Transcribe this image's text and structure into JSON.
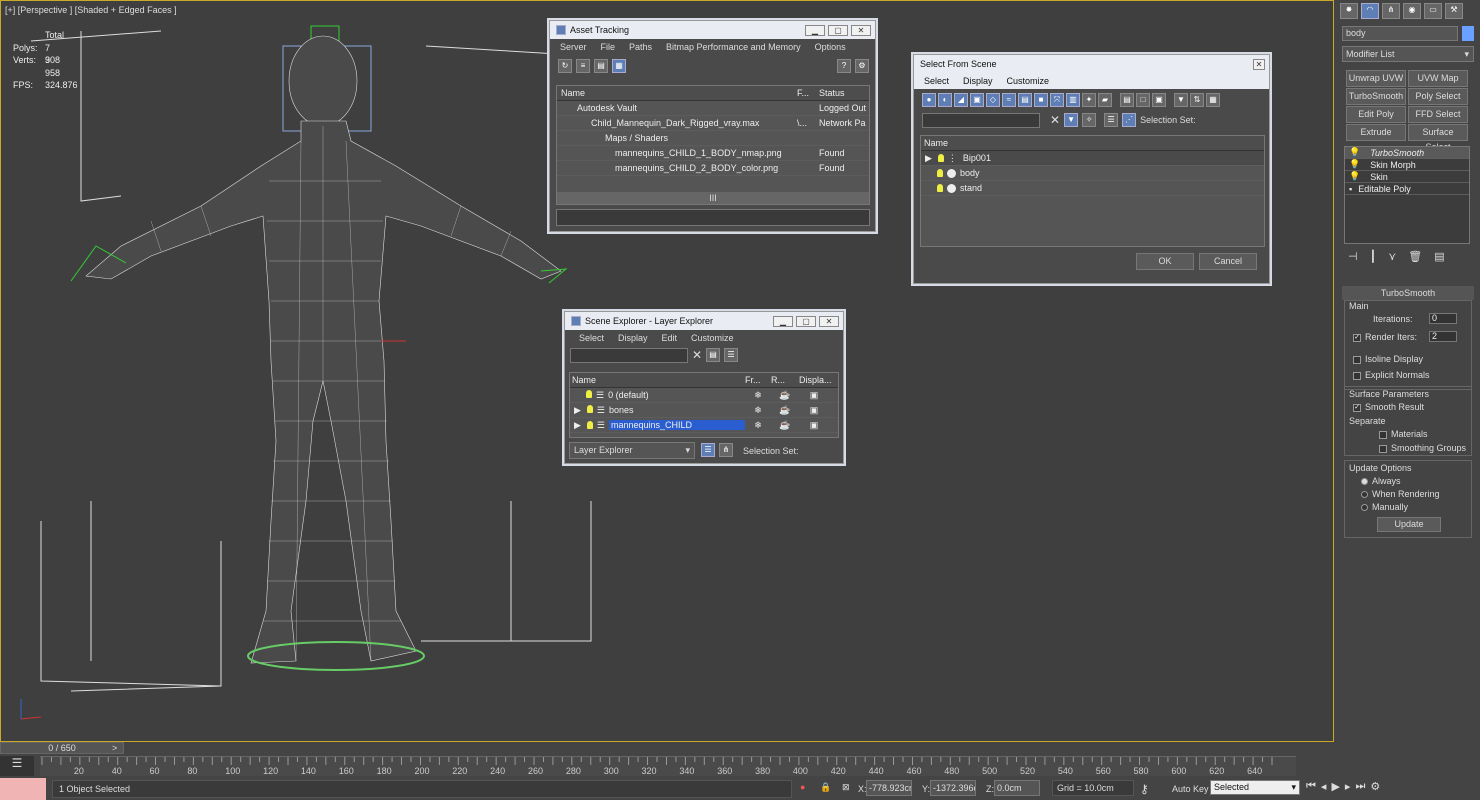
{
  "viewport": {
    "label": "[+] [Perspective ] [Shaded + Edged Faces ]",
    "stats": {
      "total": "Total",
      "polys_label": "Polys:",
      "polys": "7 908",
      "verts_label": "Verts:",
      "verts": "3 958",
      "fps_label": "FPS:",
      "fps": "324.876"
    }
  },
  "asset_tracking": {
    "title": "Asset Tracking",
    "menu": [
      "Server",
      "File",
      "Paths",
      "Bitmap Performance and Memory",
      "Options"
    ],
    "cols": [
      "Name",
      "F...",
      "Status"
    ],
    "rows": [
      {
        "name": "Autodesk Vault",
        "f": "",
        "status": "Logged Out"
      },
      {
        "name": "Child_Mannequin_Dark_Rigged_vray.max",
        "f": "\\...",
        "status": "Network Pa"
      },
      {
        "name": "Maps / Shaders",
        "f": "",
        "status": ""
      },
      {
        "name": "mannequins_CHILD_1_BODY_nmap.png",
        "f": "",
        "status": "Found"
      },
      {
        "name": "mannequins_CHILD_2_BODY_color.png",
        "f": "",
        "status": "Found"
      }
    ],
    "scroll_label": "III"
  },
  "select_from_scene": {
    "title": "Select From Scene",
    "menu": [
      "Select",
      "Display",
      "Customize"
    ],
    "selection_set": "Selection Set:",
    "col_name": "Name",
    "rows": [
      "Bip001",
      "body",
      "stand"
    ],
    "ok": "OK",
    "cancel": "Cancel"
  },
  "scene_explorer": {
    "title": "Scene Explorer - Layer Explorer",
    "menu": [
      "Select",
      "Display",
      "Edit",
      "Customize"
    ],
    "cols": [
      "Name",
      "Fr...",
      "R...",
      "Displa..."
    ],
    "rows": [
      "0 (default)",
      "bones",
      "mannequins_CHILD"
    ],
    "layer_dropdown": "Layer Explorer",
    "selection_set": "Selection Set:"
  },
  "cmd_panel": {
    "object_name": "body",
    "modifier_list": "Modifier List",
    "buttons": [
      "Unwrap UVW",
      "UVW Map",
      "TurboSmooth",
      "Poly Select",
      "Edit Poly",
      "FFD Select",
      "Extrude",
      "Surface Select"
    ],
    "stack": [
      "TurboSmooth",
      "Skin Morph",
      "Skin",
      "Editable Poly"
    ],
    "rollout": "TurboSmooth",
    "main": "Main",
    "iterations_label": "Iterations:",
    "iterations": "0",
    "render_iters_label": "Render Iters:",
    "render_iters": "2",
    "isoline": "Isoline Display",
    "explicit": "Explicit Normals",
    "surface_params": "Surface Parameters",
    "smooth_result": "Smooth Result",
    "separate": "Separate",
    "materials": "Materials",
    "smoothing_groups": "Smoothing Groups",
    "update_options": "Update Options",
    "always": "Always",
    "when_rendering": "When Rendering",
    "manually": "Manually",
    "update": "Update"
  },
  "timeline": {
    "frame": "0 / 650",
    "ticks": [
      "20",
      "40",
      "60",
      "80",
      "100",
      "120",
      "140",
      "160",
      "180",
      "200",
      "220",
      "240",
      "260",
      "280",
      "300",
      "320",
      "340",
      "360",
      "380",
      "400",
      "420",
      "440",
      "460",
      "480",
      "500",
      "520",
      "540",
      "560",
      "580",
      "600",
      "620",
      "640"
    ],
    "status": "1 Object Selected",
    "x_label": "X:",
    "x": "-778.923cr",
    "y_label": "Y:",
    "y": "-1372.396c",
    "z_label": "Z:",
    "z": "0.0cm",
    "grid": "Grid = 10.0cm",
    "autokey": "Auto Key",
    "selected": "Selected"
  }
}
